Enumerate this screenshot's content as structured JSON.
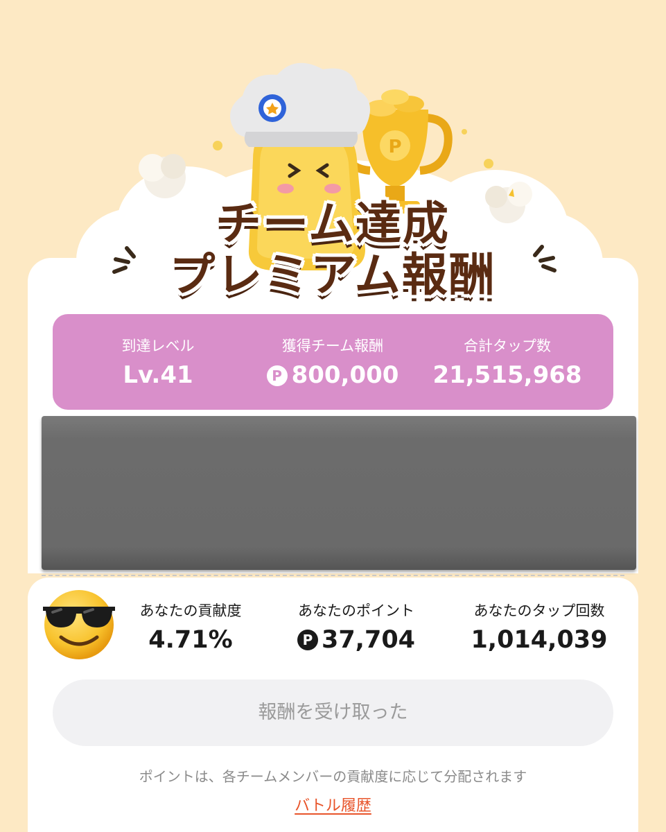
{
  "title": {
    "line1": "チーム達成",
    "line2": "プレミアム報酬"
  },
  "team_stats": {
    "level_label": "到達レベル",
    "level_value": "Lv.41",
    "reward_label": "獲得チーム報酬",
    "reward_value": "800,000",
    "taps_label": "合計タップ数",
    "taps_value": "21,515,968"
  },
  "point_symbol": "P",
  "personal": {
    "contribution_label": "あなたの貢献度",
    "contribution_value": "4.71%",
    "points_label": "あなたのポイント",
    "points_value": "37,704",
    "taps_label": "あなたのタップ回数",
    "taps_value": "1,014,039"
  },
  "claim_button": "報酬を受け取った",
  "note": "ポイントは、各チームメンバーの貢献度に応じて分配されます",
  "history_link": "バトル履歴",
  "colors": {
    "background": "#fde9c4",
    "stats_panel": "#d98fca",
    "title_text": "#5a2b12",
    "link": "#e8542a",
    "button_bg": "#f1f1f3"
  }
}
